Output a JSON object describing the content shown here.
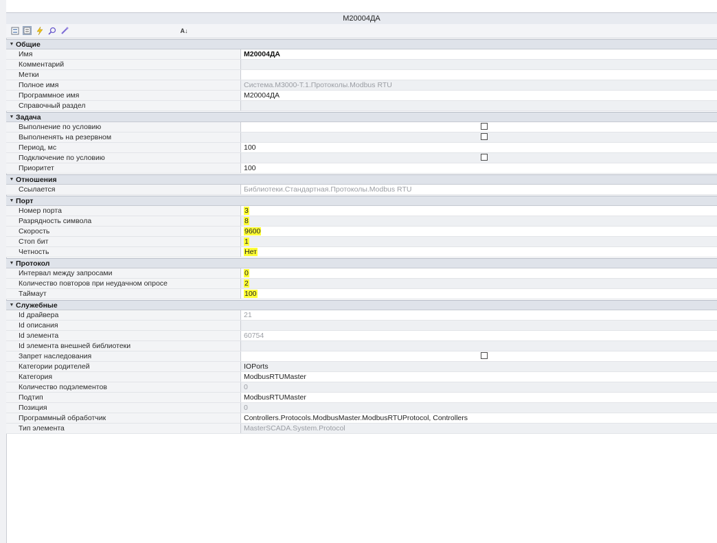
{
  "window": {
    "title": "М20004ДА"
  },
  "toolbar": {
    "icons": [
      "categorized-view-icon",
      "properties-view-icon",
      "events-icon",
      "search-icon",
      "edit-icon",
      "sort-az-icon"
    ],
    "sort_label": "A↓"
  },
  "groups": [
    {
      "name": "Общие",
      "rows": [
        {
          "label": "Имя",
          "value": "М20004ДА",
          "style": "bold"
        },
        {
          "label": "Комментарий",
          "value": ""
        },
        {
          "label": "Метки",
          "value": ""
        },
        {
          "label": "Полное имя",
          "value": "Система.М3000-Т.1.Протоколы.Modbus RTU",
          "style": "ro"
        },
        {
          "label": "Программное имя",
          "value": "М20004ДА"
        },
        {
          "label": "Справочный раздел",
          "value": ""
        }
      ]
    },
    {
      "name": "Задача",
      "rows": [
        {
          "label": "Выполнение по условию",
          "value": "",
          "checkbox": true
        },
        {
          "label": "Выполненять на резервном",
          "value": "",
          "checkbox": true
        },
        {
          "label": "Период, мс",
          "value": "100"
        },
        {
          "label": "Подключение по условию",
          "value": "",
          "checkbox": true
        },
        {
          "label": "Приоритет",
          "value": "100"
        }
      ]
    },
    {
      "name": "Отношения",
      "rows": [
        {
          "label": "Ссылается",
          "value": "Библиотеки.Стандартная.Протоколы.Modbus RTU",
          "style": "ro"
        }
      ]
    },
    {
      "name": "Порт",
      "rows": [
        {
          "label": "Номер порта",
          "value": "3",
          "highlight": true
        },
        {
          "label": "Разрядность символа",
          "value": "8",
          "highlight": true
        },
        {
          "label": "Скорость",
          "value": "9600",
          "highlight": true
        },
        {
          "label": "Стоп бит",
          "value": "1",
          "highlight": true
        },
        {
          "label": "Четность",
          "value": "Нет",
          "highlight": true
        }
      ]
    },
    {
      "name": "Протокол",
      "rows": [
        {
          "label": "Интервал между запросами",
          "value": "0",
          "highlight": true
        },
        {
          "label": "Количество повторов при неудачном опросе",
          "value": "2",
          "highlight": true
        },
        {
          "label": "Таймаут",
          "value": "100",
          "highlight": true
        }
      ]
    },
    {
      "name": "Служебные",
      "rows": [
        {
          "label": "Id драйвера",
          "value": "21",
          "style": "ro"
        },
        {
          "label": "Id описания",
          "value": ""
        },
        {
          "label": "Id элемента",
          "value": "60754",
          "style": "ro"
        },
        {
          "label": "Id элемента внешней библиотеки",
          "value": ""
        },
        {
          "label": "Запрет наследования",
          "value": "",
          "checkbox": true
        },
        {
          "label": "Категории родителей",
          "value": "IOPorts"
        },
        {
          "label": "Категория",
          "value": "ModbusRTUMaster"
        },
        {
          "label": "Количество подэлементов",
          "value": "0",
          "style": "ro"
        },
        {
          "label": "Подтип",
          "value": "ModbusRTUMaster"
        },
        {
          "label": "Позиция",
          "value": "0",
          "style": "ro"
        },
        {
          "label": "Программный обработчик",
          "value": "Controllers.Protocols.ModbusMaster.ModbusRTUProtocol, Controllers"
        },
        {
          "label": "Тип элемента",
          "value": "MasterSCADA.System.Protocol",
          "style": "ro"
        }
      ]
    }
  ]
}
